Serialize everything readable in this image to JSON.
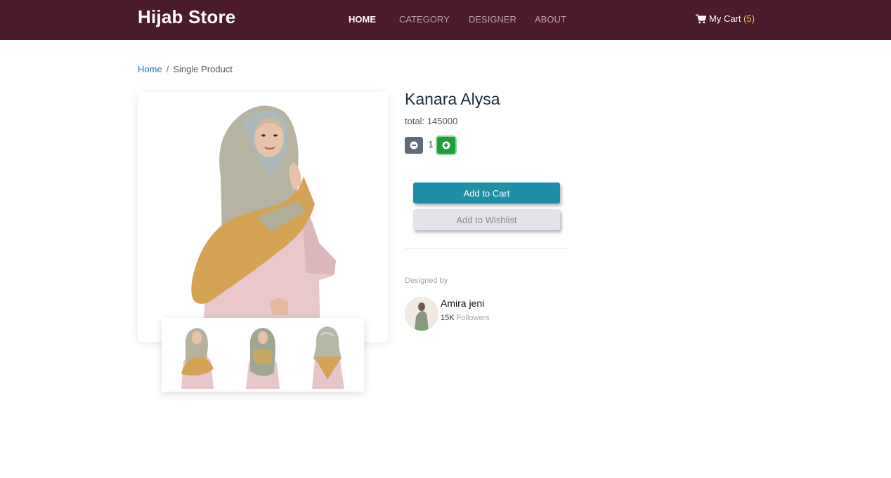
{
  "navbar": {
    "brand": "Hijab Store",
    "links": [
      "HOME",
      "CATEGORY",
      "DESIGNER",
      "ABOUT"
    ],
    "active_link": "HOME",
    "cart_label": "My Cart",
    "cart_open": "(",
    "cart_count": "5",
    "cart_close": ")",
    "cart_icon": "cart-icon",
    "colors": {
      "background": "#4b1a2c",
      "cart_count": "#f4c542"
    }
  },
  "breadcrumb": {
    "home": "Home",
    "separator": "/",
    "current": "Single Product"
  },
  "product": {
    "name": "Kanara Alysa",
    "total_text": "total: 145000",
    "quantity": "1",
    "minus_icon": "minus-circle-icon",
    "plus_icon": "plus-circle-icon",
    "add_to_cart": "Add to Cart",
    "add_to_wishlist": "Add to Wishlist",
    "colors": {
      "add_to_cart": "#1f8fa6",
      "plus_button": "#1e9e3a",
      "minus_button": "#5f6b78"
    }
  },
  "designer": {
    "label": "Designed by",
    "name": "Amira jeni",
    "followers_count": "15K",
    "followers_label": "Followers"
  }
}
